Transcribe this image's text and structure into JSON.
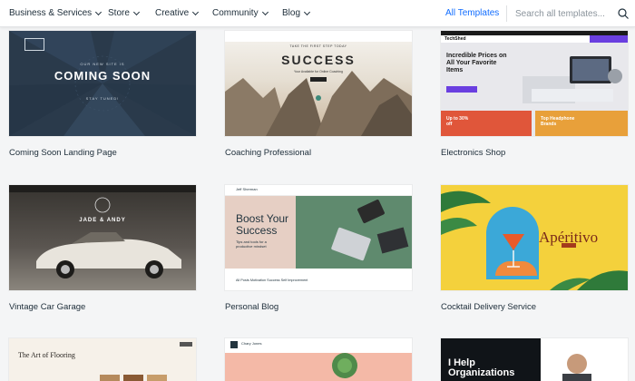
{
  "nav": {
    "items": [
      {
        "label": "Business & Services"
      },
      {
        "label": "Store"
      },
      {
        "label": "Creative"
      },
      {
        "label": "Community"
      },
      {
        "label": "Blog"
      }
    ],
    "all_templates": "All Templates",
    "search_placeholder": "Search all templates...",
    "accent_color": "#116dff"
  },
  "templates": [
    {
      "label": "Coming Soon Landing Page",
      "hero_small": "OUR NEW SITE IS",
      "hero_title": "COMING SOON",
      "hero_sub": "STAY TUNED!"
    },
    {
      "label": "Coaching Professional",
      "hero_small": "TAKE THE FIRST STEP TODAY",
      "hero_title": "SUCCESS",
      "hero_sub": "Your Available for Online Coaching"
    },
    {
      "label": "Electronics Shop",
      "brand": "TechShed",
      "hero_title": "Incredible Prices on All Your Favorite Items",
      "promo_left": "Up to 30% off",
      "promo_right": "Top Headphone Brands"
    },
    {
      "label": "Vintage Car Garage",
      "hero_title": "JADE & ANDY"
    },
    {
      "label": "Personal Blog",
      "author": "Jeff Sherman",
      "hero_title": "Boost Your Success",
      "hero_sub": "Tips and tools for a productive mindset",
      "categories": "All Posts   Motivation   Success   Self Improvement"
    },
    {
      "label": "Cocktail Delivery Service",
      "hero_title": "Apéritivo"
    },
    {
      "label": "",
      "hero_title": "The Art of Flooring"
    },
    {
      "label": "",
      "brand": "Chary Jones"
    },
    {
      "label": "",
      "hero_title": "I Help Organizations"
    }
  ]
}
